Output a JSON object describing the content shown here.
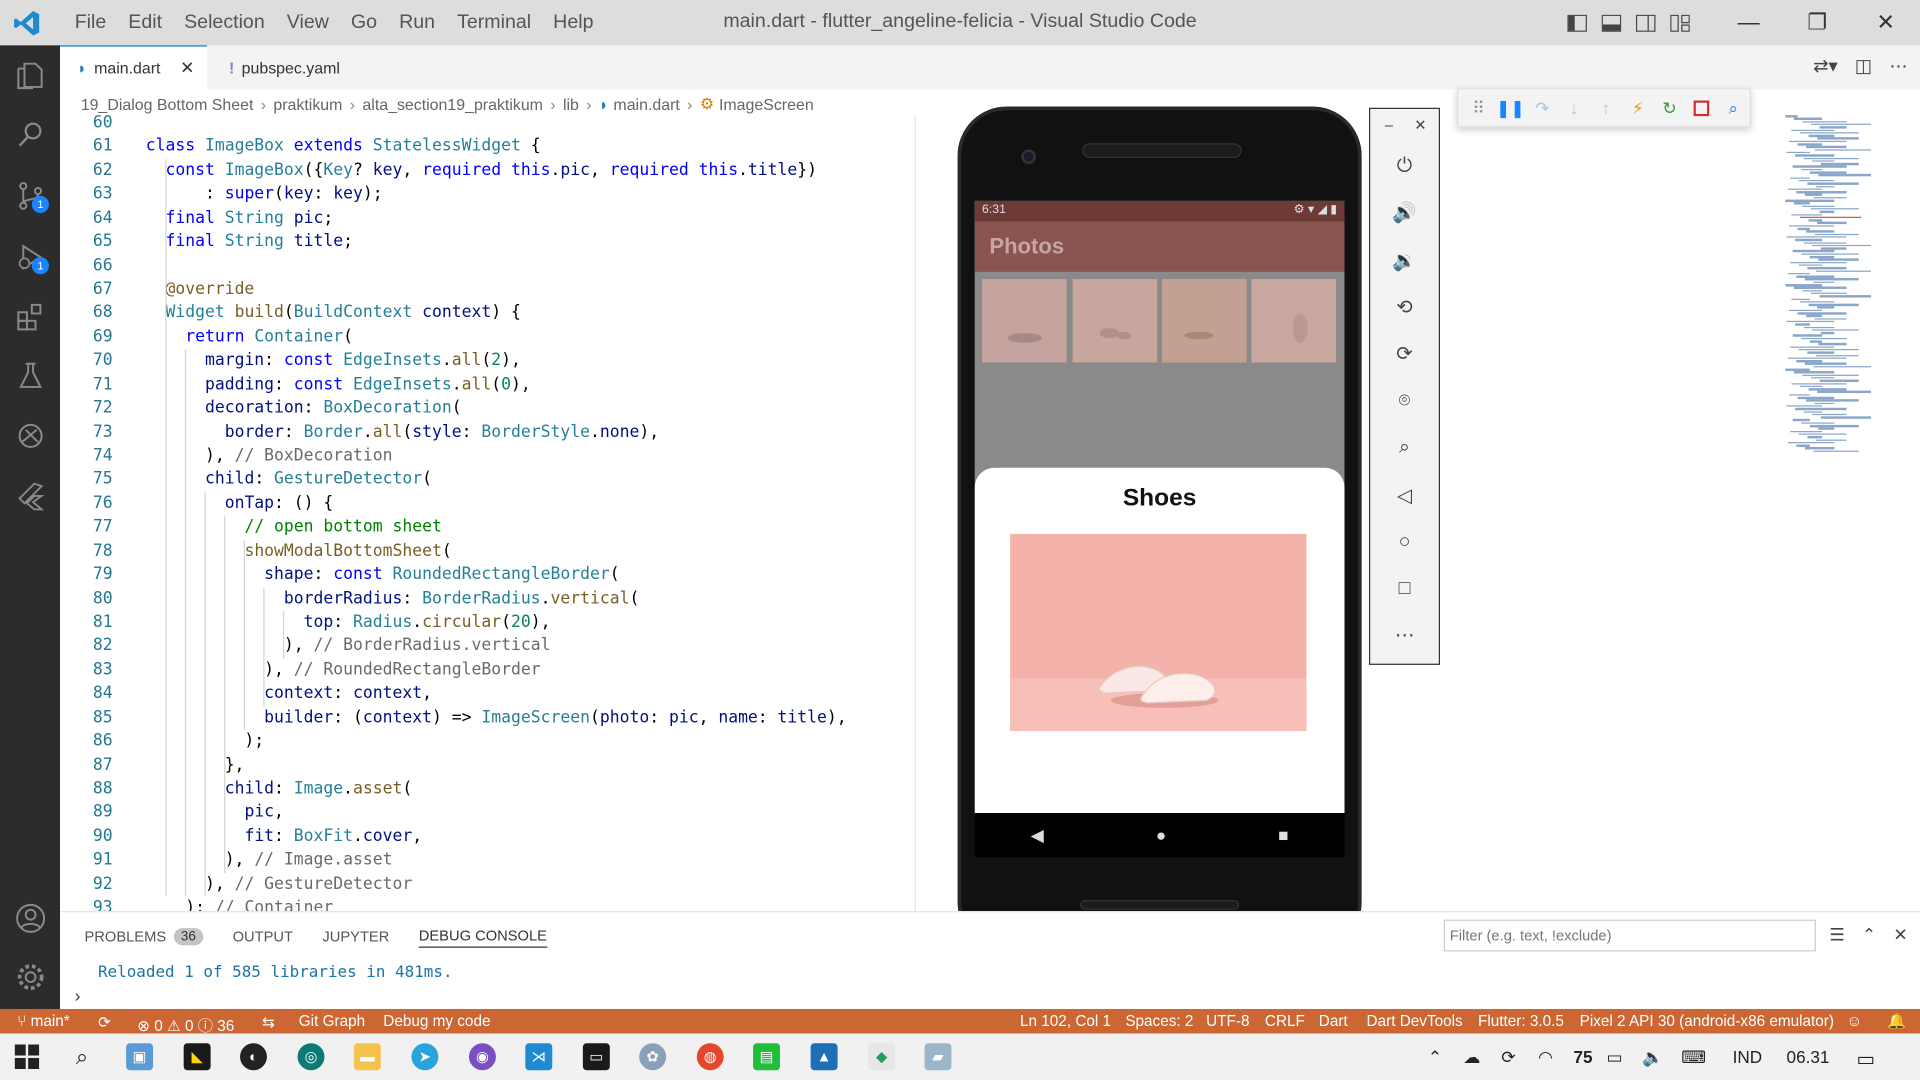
{
  "window": {
    "title": "main.dart - flutter_angeline-felicia - Visual Studio Code",
    "menu": [
      "File",
      "Edit",
      "Selection",
      "View",
      "Go",
      "Run",
      "Terminal",
      "Help"
    ]
  },
  "activity_bar": {
    "items": [
      {
        "name": "explorer-icon"
      },
      {
        "name": "search-icon"
      },
      {
        "name": "source-control-icon",
        "badge": "1"
      },
      {
        "name": "run-debug-icon",
        "badge": "1"
      },
      {
        "name": "extensions-icon"
      },
      {
        "name": "testing-icon"
      },
      {
        "name": "remote-explorer-icon"
      },
      {
        "name": "flutter-icon"
      }
    ],
    "bottom": [
      "accounts-icon",
      "settings-gear-icon"
    ]
  },
  "tabs": [
    {
      "label": "main.dart",
      "active": true
    },
    {
      "label": "pubspec.yaml",
      "active": false
    }
  ],
  "breadcrumb": [
    "19_Dialog Bottom Sheet",
    "praktikum",
    "alta_section19_praktikum",
    "lib",
    "main.dart",
    "ImageScreen"
  ],
  "editor": {
    "lines": [
      {
        "n": "60",
        "t": ""
      },
      {
        "n": "61",
        "t": "class ImageBox extends StatelessWidget {"
      },
      {
        "n": "62",
        "t": "  const ImageBox({Key? key, required this.pic, required this.title})"
      },
      {
        "n": "63",
        "t": "      : super(key: key);"
      },
      {
        "n": "64",
        "t": "  final String pic;"
      },
      {
        "n": "65",
        "t": "  final String title;"
      },
      {
        "n": "66",
        "t": ""
      },
      {
        "n": "67",
        "t": "  @override"
      },
      {
        "n": "68",
        "t": "  Widget build(BuildContext context) {"
      },
      {
        "n": "69",
        "t": "    return Container("
      },
      {
        "n": "70",
        "t": "      margin: const EdgeInsets.all(2),"
      },
      {
        "n": "71",
        "t": "      padding: const EdgeInsets.all(0),"
      },
      {
        "n": "72",
        "t": "      decoration: BoxDecoration("
      },
      {
        "n": "73",
        "t": "        border: Border.all(style: BorderStyle.none),"
      },
      {
        "n": "74",
        "t": "      ), // BoxDecoration"
      },
      {
        "n": "75",
        "t": "      child: GestureDetector("
      },
      {
        "n": "76",
        "t": "        onTap: () {"
      },
      {
        "n": "77",
        "t": "          // open bottom sheet"
      },
      {
        "n": "78",
        "t": "          showModalBottomSheet("
      },
      {
        "n": "79",
        "t": "            shape: const RoundedRectangleBorder("
      },
      {
        "n": "80",
        "t": "              borderRadius: BorderRadius.vertical("
      },
      {
        "n": "81",
        "t": "                top: Radius.circular(20),"
      },
      {
        "n": "82",
        "t": "              ), // BorderRadius.vertical"
      },
      {
        "n": "83",
        "t": "            ), // RoundedRectangleBorder"
      },
      {
        "n": "84",
        "t": "            context: context,"
      },
      {
        "n": "85",
        "t": "            builder: (context) => ImageScreen(photo: pic, name: title),"
      },
      {
        "n": "86",
        "t": "          );"
      },
      {
        "n": "87",
        "t": "        },"
      },
      {
        "n": "88",
        "t": "        child: Image.asset("
      },
      {
        "n": "89",
        "t": "          pic,"
      },
      {
        "n": "90",
        "t": "          fit: BoxFit.cover,"
      },
      {
        "n": "91",
        "t": "        ), // Image.asset"
      },
      {
        "n": "92",
        "t": "      ), // GestureDetector"
      },
      {
        "n": "93",
        "t": "    ); // Container"
      }
    ]
  },
  "emulator": {
    "status_time": "6:31",
    "app_title": "Photos",
    "sheet_title": "Shoes",
    "controls": [
      "power-icon",
      "volume-up-icon",
      "volume-down-icon",
      "rotate-left-icon",
      "rotate-right-icon",
      "camera-icon",
      "zoom-icon",
      "back-icon",
      "home-icon",
      "overview-icon",
      "more-icon"
    ]
  },
  "panel": {
    "tabs": [
      {
        "label": "PROBLEMS",
        "badge": "36"
      },
      {
        "label": "OUTPUT"
      },
      {
        "label": "JUPYTER"
      },
      {
        "label": "DEBUG CONSOLE",
        "active": true
      }
    ],
    "filter_placeholder": "Filter (e.g. text, !exclude)",
    "console_output": "Reloaded 1 of 585 libraries in 481ms."
  },
  "statusbar": {
    "branch": "main*",
    "problems": "⊗ 0 ⚠ 0 ⓘ 36",
    "git_graph": "Git Graph",
    "debug": "Debug my code",
    "position": "Ln 102, Col 1",
    "spaces": "Spaces: 2",
    "encoding": "UTF-8",
    "eol": "CRLF",
    "language": "Dart",
    "devtools": "Dart DevTools",
    "flutter": "Flutter: 3.0.5",
    "device": "Pixel 2 API 30 (android-x86 emulator)"
  },
  "taskbar": {
    "battery": "75",
    "lang": "IND",
    "time": "06.31"
  },
  "colors": {
    "keyword": "#0000ff",
    "type": "#267f99",
    "function": "#795e26",
    "variable": "#001080",
    "comment": "#6a6a6a",
    "statusbar": "#cc6633"
  }
}
